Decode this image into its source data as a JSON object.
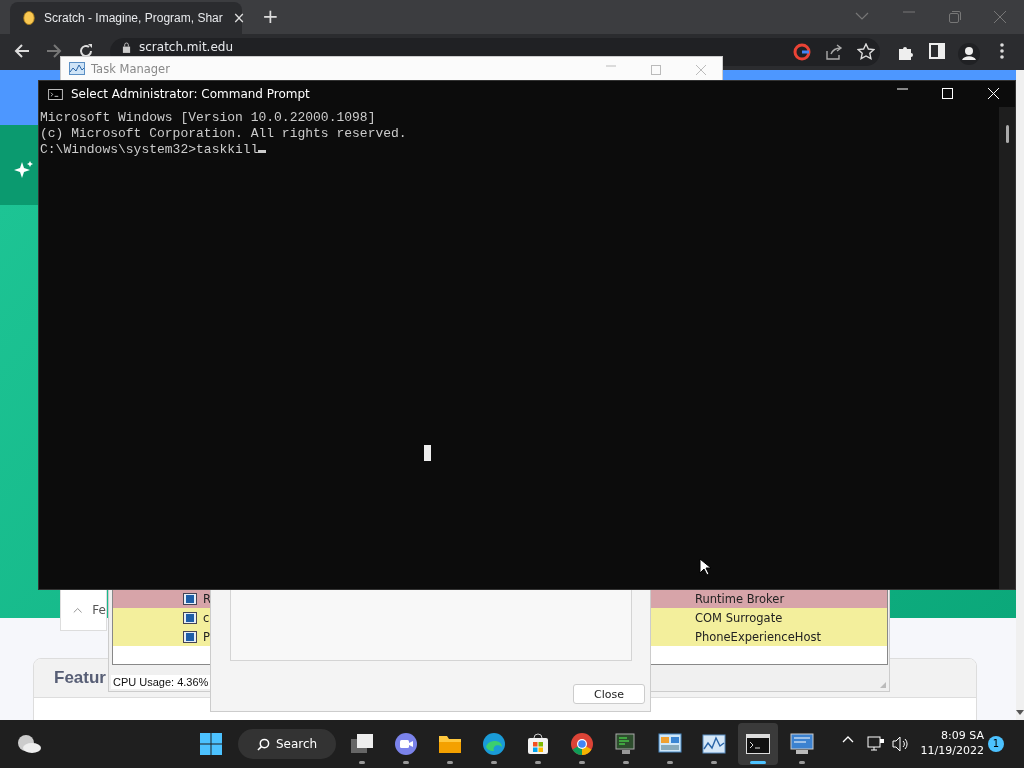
{
  "browser": {
    "tab_title": "Scratch - Imagine, Program, Shar",
    "tab_close": "×",
    "new_tab": "+",
    "address": "scratch.mit.edu"
  },
  "page": {
    "collapsed_item": "Fe",
    "card_title": "Featur"
  },
  "task_manager": {
    "title": "Task Manager"
  },
  "process_list": {
    "rows": [
      {
        "column_1": "R",
        "column_2": "Runtime Broker",
        "color": "#d7a4a9"
      },
      {
        "column_1": "c",
        "column_2": "COM Surrogate",
        "color": "#f3ef9c"
      },
      {
        "column_1": "P",
        "column_2": "PhoneExperienceHost",
        "color": "#f3ef9c"
      }
    ],
    "status": "CPU Usage: 4.36%"
  },
  "dialog": {
    "close_button": "Close"
  },
  "command_prompt": {
    "title": "Select Administrator: Command Prompt",
    "lines": [
      "Microsoft Windows [Version 10.0.22000.1098]",
      "(c) Microsoft Corporation. All rights reserved.",
      "C:\\Windows\\system32>taskkill"
    ]
  },
  "taskbar": {
    "search_label": "Search",
    "apps": [
      {
        "kind": "taskview",
        "selected": false
      },
      {
        "kind": "chat",
        "selected": false
      },
      {
        "kind": "folder",
        "selected": false
      },
      {
        "kind": "edge",
        "selected": false
      },
      {
        "kind": "store",
        "selected": false
      },
      {
        "kind": "chrome",
        "selected": false
      },
      {
        "kind": "terminal",
        "selected": false
      },
      {
        "kind": "panel",
        "selected": false
      },
      {
        "kind": "monitor",
        "selected": false
      },
      {
        "kind": "cmd",
        "selected": true
      },
      {
        "kind": "remote",
        "selected": false
      }
    ],
    "time": "8:09 SA",
    "date": "11/19/2022",
    "notification_count": "1"
  }
}
